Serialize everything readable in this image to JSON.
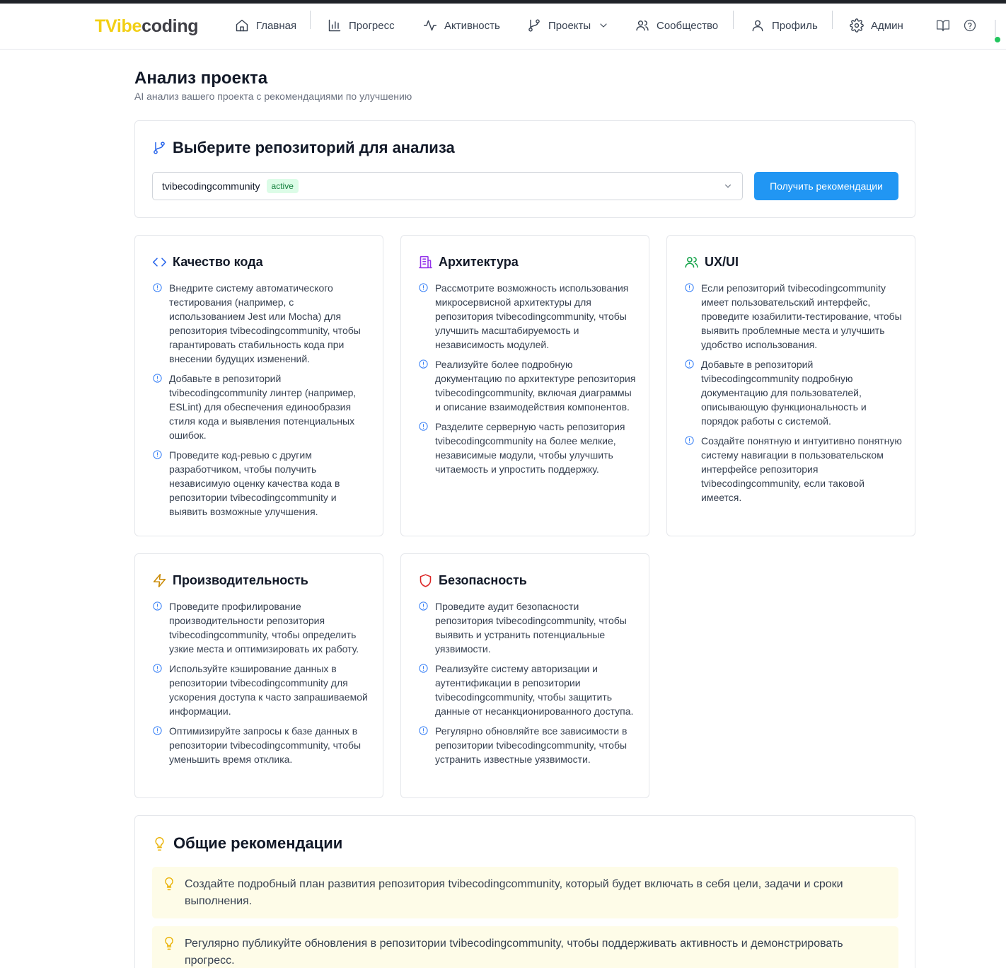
{
  "logo": {
    "part1": "TVibe",
    "part2": "coding"
  },
  "nav": {
    "home": "Главная",
    "progress": "Прогресс",
    "activity": "Активность",
    "projects": "Проекты",
    "community": "Сообщество",
    "profile": "Профиль",
    "admin": "Админ"
  },
  "page": {
    "title": "Анализ проекта",
    "subtitle": "AI анализ вашего проекта с рекомендациями по улучшению"
  },
  "repo_selector": {
    "title": "Выберите репозиторий для анализа",
    "selected": "tvibecodingcommunity",
    "badge": "active",
    "button": "Получить рекомендации"
  },
  "categories": [
    {
      "title": "Качество кода",
      "icon": "code-icon",
      "color": "#2563eb",
      "items": [
        "Внедрите систему автоматического тестирования (например, с использованием Jest или Mocha) для репозитория tvibecodingcommunity, чтобы гарантировать стабильность кода при внесении будущих изменений.",
        "Добавьте в репозиторий tvibecodingcommunity линтер (например, ESLint) для обеспечения единообразия стиля кода и выявления потенциальных ошибок.",
        "Проведите код-ревью с другим разработчиком, чтобы получить независимую оценку качества кода в репозитории tvibecodingcommunity и выявить возможные улучшения."
      ]
    },
    {
      "title": "Архитектура",
      "icon": "building-icon",
      "color": "#9333ea",
      "items": [
        "Рассмотрите возможность использования микросервисной архитектуры для репозитория tvibecodingcommunity, чтобы улучшить масштабируемость и независимость модулей.",
        "Реализуйте более подробную документацию по архитектуре репозитория tvibecodingcommunity, включая диаграммы и описание взаимодействия компонентов.",
        "Разделите серверную часть репозитория tvibecodingcommunity на более мелкие, независимые модули, чтобы улучшить читаемость и упростить поддержку."
      ]
    },
    {
      "title": "UX/UI",
      "icon": "users-icon",
      "color": "#16a34a",
      "items": [
        "Если репозиторий tvibecodingcommunity имеет пользовательский интерфейс, проведите юзабилити-тестирование, чтобы выявить проблемные места и улучшить удобство использования.",
        "Добавьте в репозиторий tvibecodingcommunity подробную документацию для пользователей, описывающую функциональность и порядок работы с системой.",
        "Создайте понятную и интуитивно понятную систему навигации в пользовательском интерфейсе репозитория tvibecodingcommunity, если таковой имеется."
      ]
    },
    {
      "title": "Производительность",
      "icon": "zap-icon",
      "color": "#ca8a04",
      "items": [
        "Проведите профилирование производительности репозитория tvibecodingcommunity, чтобы определить узкие места и оптимизировать их работу.",
        "Используйте кэширование данных в репозитории tvibecodingcommunity для ускорения доступа к часто запрашиваемой информации.",
        "Оптимизируйте запросы к базе данных в репозитории tvibecodingcommunity, чтобы уменьшить время отклика."
      ]
    },
    {
      "title": "Безопасность",
      "icon": "shield-icon",
      "color": "#dc2626",
      "items": [
        "Проведите аудит безопасности репозитория tvibecodingcommunity, чтобы выявить и устранить потенциальные уязвимости.",
        "Реализуйте систему авторизации и аутентификации в репозитории tvibecodingcommunity, чтобы защитить данные от несанкционированного доступа.",
        "Регулярно обновляйте все зависимости в репозитории tvibecodingcommunity, чтобы устранить известные уязвимости."
      ]
    }
  ],
  "general": {
    "title": "Общие рекомендации",
    "items": [
      "Создайте подробный план развития репозитория tvibecodingcommunity, который будет включать в себя цели, задачи и сроки выполнения.",
      "Регулярно публикуйте обновления в репозитории tvibecodingcommunity, чтобы поддерживать активность и демонстрировать прогресс."
    ]
  },
  "colors": {
    "accent": "#2196f3",
    "brand_yellow": "#f2cf15",
    "tip_bg": "#fefce8"
  }
}
